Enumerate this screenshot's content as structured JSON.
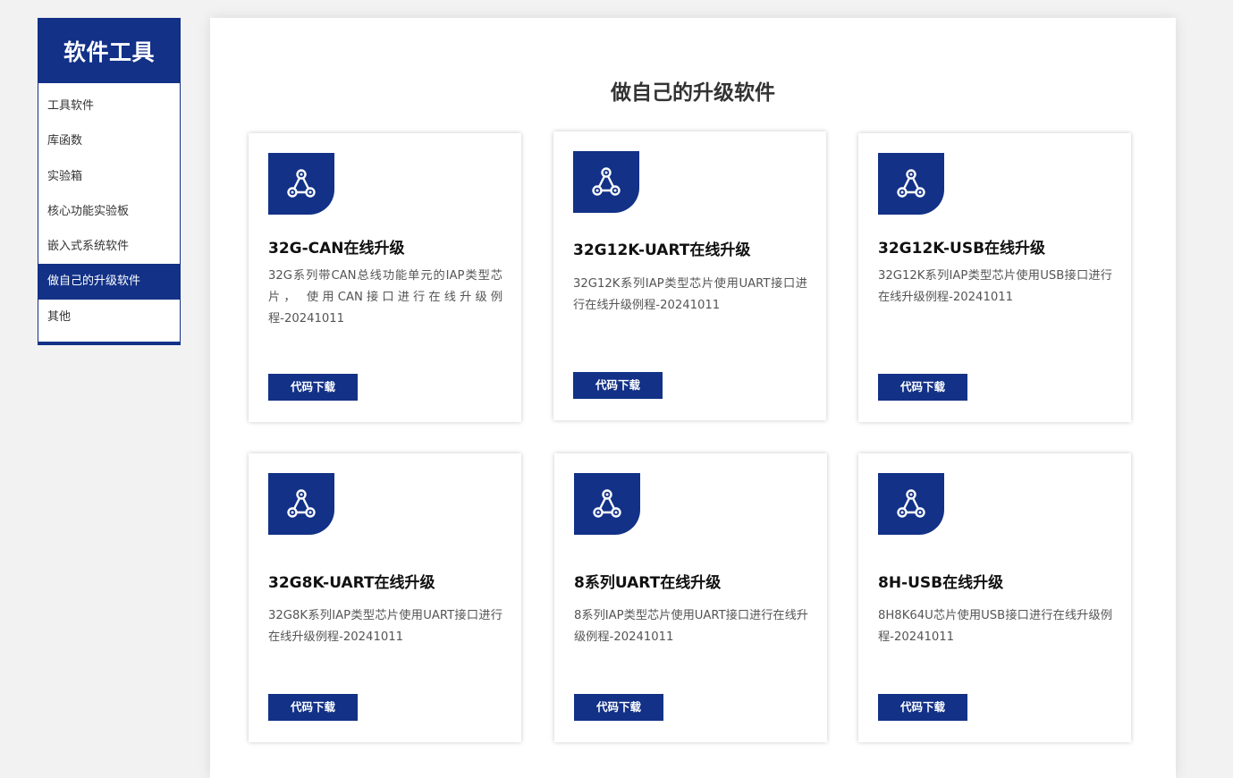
{
  "sidebar": {
    "title": "软件工具",
    "items": [
      {
        "label": "工具软件",
        "active": false
      },
      {
        "label": "库函数",
        "active": false
      },
      {
        "label": "实验箱",
        "active": false
      },
      {
        "label": "核心功能实验板",
        "active": false
      },
      {
        "label": "嵌入式系统软件",
        "active": false
      },
      {
        "label": "做自己的升级软件",
        "active": true
      },
      {
        "label": "其他",
        "active": false
      }
    ]
  },
  "main": {
    "title": "做自己的升级软件",
    "cards": [
      {
        "icon": "network-triangle-icon",
        "title": "32G-CAN在线升级",
        "description": "32G系列带CAN总线功能单元的IAP类型芯片， 使用CAN接口进行在线升级例程-20241011",
        "button_label": "代码下载"
      },
      {
        "icon": "network-triangle-icon",
        "title": "32G12K-UART在线升级",
        "description": "32G12K系列IAP类型芯片使用UART接口进行在线升级例程-20241011",
        "button_label": "代码下载"
      },
      {
        "icon": "network-triangle-icon",
        "title": "32G12K-USB在线升级",
        "description": "32G12K系列IAP类型芯片使用USB接口进行在线升级例程-20241011",
        "button_label": "代码下载"
      },
      {
        "icon": "network-triangle-icon",
        "title": "32G8K-UART在线升级",
        "description": "32G8K系列IAP类型芯片使用UART接口进行在线升级例程-20241011",
        "button_label": "代码下载"
      },
      {
        "icon": "network-triangle-icon",
        "title": "8系列UART在线升级",
        "description": "8系列IAP类型芯片使用UART接口进行在线升级例程-20241011",
        "button_label": "代码下载"
      },
      {
        "icon": "network-triangle-icon",
        "title": "8H-USB在线升级",
        "description": "8H8K64U芯片使用USB接口进行在线升级例程-20241011",
        "button_label": "代码下载"
      }
    ]
  },
  "colors": {
    "brand": "#123187",
    "background": "#f2f2f2",
    "text_dark": "#333333",
    "text_muted": "#555555"
  }
}
